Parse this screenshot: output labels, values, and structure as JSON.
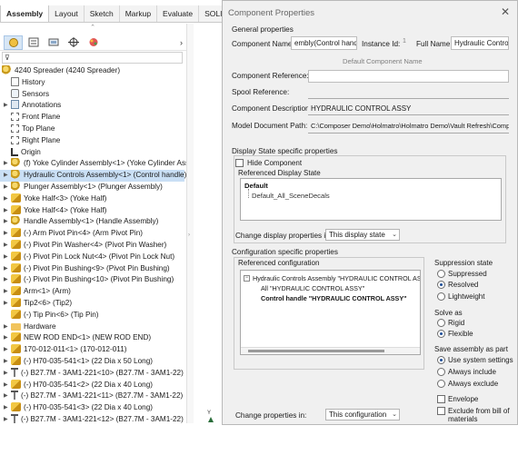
{
  "cmd_tabs": [
    "Assembly",
    "Layout",
    "Sketch",
    "Markup",
    "Evaluate",
    "SOLIDWORKS"
  ],
  "tree": {
    "root": "4240 Spreader  (4240 Spreader)",
    "items": [
      {
        "label": "History",
        "icon": "history-icon"
      },
      {
        "label": "Sensors",
        "icon": "sensor-icon"
      },
      {
        "label": "Annotations",
        "icon": "annotations-icon"
      },
      {
        "label": "Front Plane",
        "icon": "plane-icon"
      },
      {
        "label": "Top Plane",
        "icon": "plane-icon"
      },
      {
        "label": "Right Plane",
        "icon": "plane-icon"
      },
      {
        "label": "Origin",
        "icon": "origin-icon"
      },
      {
        "label": "(f) Yoke Cylinder Assembly<1> (Yoke Cylinder Ass",
        "icon": "assembly-icon"
      },
      {
        "label": "Hydraulic Controls Assembly<1> (Control handle)",
        "icon": "assembly-icon"
      },
      {
        "label": "Plunger Assembly<1> (Plunger Assembly)",
        "icon": "assembly-icon"
      },
      {
        "label": "Yoke Half<3> (Yoke Half)",
        "icon": "part-icon"
      },
      {
        "label": "Yoke Half<4> (Yoke Half)",
        "icon": "part-icon"
      },
      {
        "label": "Handle Assembly<1> (Handle Assembly)",
        "icon": "assembly-icon"
      },
      {
        "label": "(-) Arm Pivot Pin<4> (Arm Pivot Pin)",
        "icon": "part-icon"
      },
      {
        "label": "(-) Pivot Pin Washer<4> (Pivot Pin Washer)",
        "icon": "part-icon"
      },
      {
        "label": "(-) Pivot Pin Lock Nut<4> (Pivot Pin Lock Nut)",
        "icon": "part-icon"
      },
      {
        "label": "(-) Pivot Pin Bushing<9> (Pivot Pin Bushing)",
        "icon": "part-icon"
      },
      {
        "label": "(-) Pivot Pin Bushing<10> (Pivot Pin Bushing)",
        "icon": "part-icon"
      },
      {
        "label": "Arm<1> (Arm)",
        "icon": "part-icon"
      },
      {
        "label": "Tip2<6> (Tip2)",
        "icon": "part-icon"
      },
      {
        "label": "(-) Tip Pin<6> (Tip Pin)",
        "icon": "part-icon"
      },
      {
        "label": "Hardware",
        "icon": "folder-icon"
      },
      {
        "label": "NEW ROD END<1> (NEW ROD END)",
        "icon": "part-icon"
      },
      {
        "label": "170-012-011<1> (170-012-011)",
        "icon": "part-icon"
      },
      {
        "label": "(-) H70-035-541<1> (22 Dia x 50 Long)",
        "icon": "part-icon"
      },
      {
        "label": "(-) B27.7M - 3AM1-221<10> (B27.7M - 3AM1-22)",
        "icon": "bolt-icon"
      },
      {
        "label": "(-) H70-035-541<2> (22 Dia x 40 Long)",
        "icon": "part-icon"
      },
      {
        "label": "(-) B27.7M - 3AM1-221<11> (B27.7M - 3AM1-22)",
        "icon": "bolt-icon"
      },
      {
        "label": "(-) H70-035-541<3> (22 Dia x 40 Long)",
        "icon": "part-icon"
      },
      {
        "label": "(-) B27.7M - 3AM1-221<12> (B27.7M - 3AM1-22)",
        "icon": "bolt-icon"
      }
    ]
  },
  "graphics": {
    "axis_label": "Y"
  },
  "dialog": {
    "title": "Component Properties",
    "general_title": "General properties",
    "component_name_label": "Component Name:",
    "component_name_value": "embly(Control handle)",
    "instance_id_label": "Instance Id:",
    "instance_id_value": "1",
    "full_name_label": "Full Name:",
    "full_name_value": "Hydraulic Controls",
    "default_btn": "Default",
    "component_name_btn": "Component Name",
    "component_reference_label": "Component Reference:",
    "spool_reference_label": "Spool Reference:",
    "component_description_label": "Component Description:",
    "component_description_value": "HYDRAULIC CONTROL ASSY",
    "model_path_label": "Model Document Path:",
    "model_path_value": "C:\\Composer Demo\\Holmatro\\Holmatro Demo\\Vault Refresh\\Compo",
    "display_state_title": "Display State specific properties",
    "hide_component": "Hide Component",
    "referenced_display_state": "Referenced Display State",
    "display_states": [
      "Default",
      "Default_All_SceneDecals"
    ],
    "change_display_label": "Change display properties in:",
    "change_display_value": "This display state",
    "config_title": "Configuration specific properties",
    "referenced_config": "Referenced configuration",
    "config_tree": [
      "Hydraulic Controls Assembly \"HYDRAULIC CONTROL ASSY\"",
      "All \"HYDRAULIC CONTROL  ASSY\"",
      "Control handle \"HYDRAULIC CONTROL ASSY\""
    ],
    "suppression_title": "Suppression state",
    "suppression": {
      "suppressed": "Suppressed",
      "resolved": "Resolved",
      "lightweight": "Lightweight"
    },
    "solve_title": "Solve as",
    "solve": {
      "rigid": "Rigid",
      "flexible": "Flexible"
    },
    "save_title": "Save assembly as part",
    "save": {
      "system": "Use system settings",
      "always_include": "Always include",
      "always_exclude": "Always exclude"
    },
    "envelope": "Envelope",
    "exclude_bom": "Exclude from bill of materials",
    "change_props_label": "Change properties in:",
    "change_props_value": "This configuration"
  },
  "colors": {
    "selection": "#c9dff5",
    "radio_dot": "#1f4f99"
  }
}
